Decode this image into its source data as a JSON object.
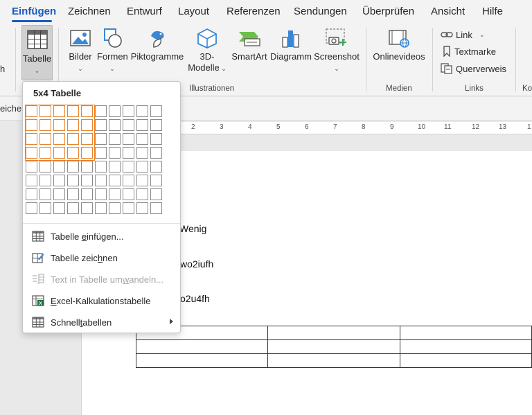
{
  "tabs": [
    {
      "label": "Einfügen",
      "active": true
    },
    {
      "label": "Zeichnen"
    },
    {
      "label": "Entwurf"
    },
    {
      "label": "Layout"
    },
    {
      "label": "Referenzen"
    },
    {
      "label": "Sendungen"
    },
    {
      "label": "Überprüfen"
    },
    {
      "label": "Ansicht"
    },
    {
      "label": "Hilfe"
    }
  ],
  "ribbon": {
    "left_cut_label": "h",
    "table_label": "Tabelle",
    "pictures_label": "Bilder",
    "shapes_label": "Formen",
    "icons_label": "Piktogramme",
    "models_label_1": "3D-",
    "models_label_2": "Modelle",
    "smartart_label": "SmartArt",
    "chart_label": "Diagramm",
    "screenshot_label": "Screenshot",
    "online_videos_label": "Onlinevideos",
    "link_label": "Link",
    "bookmark_label": "Textmarke",
    "crossref_label": "Querverweis",
    "groups": {
      "illustrations": "Illustrationen",
      "media": "Medien",
      "links": "Links",
      "cut": "Ko"
    }
  },
  "subbar": {
    "text": "eichen"
  },
  "ruler": [
    "2",
    "3",
    "4",
    "5",
    "6",
    "7",
    "8",
    "9",
    "10",
    "11",
    "12",
    "13",
    "1"
  ],
  "document": {
    "lines": [
      "Wenig",
      "wo2iufh",
      "o2u4fh"
    ]
  },
  "table_menu": {
    "title": "5x4 Tabelle",
    "grid_cols": 10,
    "grid_rows": 8,
    "selected_cols": 5,
    "selected_rows": 4,
    "items": [
      {
        "pre": "Tabelle ",
        "u": "e",
        "post": "infügen...",
        "disabled": false,
        "submenu": false
      },
      {
        "pre": "Tabelle zeic",
        "u": "h",
        "post": "nen",
        "disabled": false,
        "submenu": false
      },
      {
        "pre": "Text in Tabelle um",
        "u": "w",
        "post": "andeln...",
        "disabled": true,
        "submenu": false
      },
      {
        "pre": "",
        "u": "E",
        "post": "xcel-Kalkulationstabelle",
        "disabled": false,
        "submenu": false
      },
      {
        "pre": "Schnell",
        "u": "t",
        "post": "abellen",
        "disabled": false,
        "submenu": true
      }
    ]
  },
  "colors": {
    "accent": "#185abd",
    "grid_selection": "#e8832a",
    "excel_green": "#1d6f42"
  }
}
